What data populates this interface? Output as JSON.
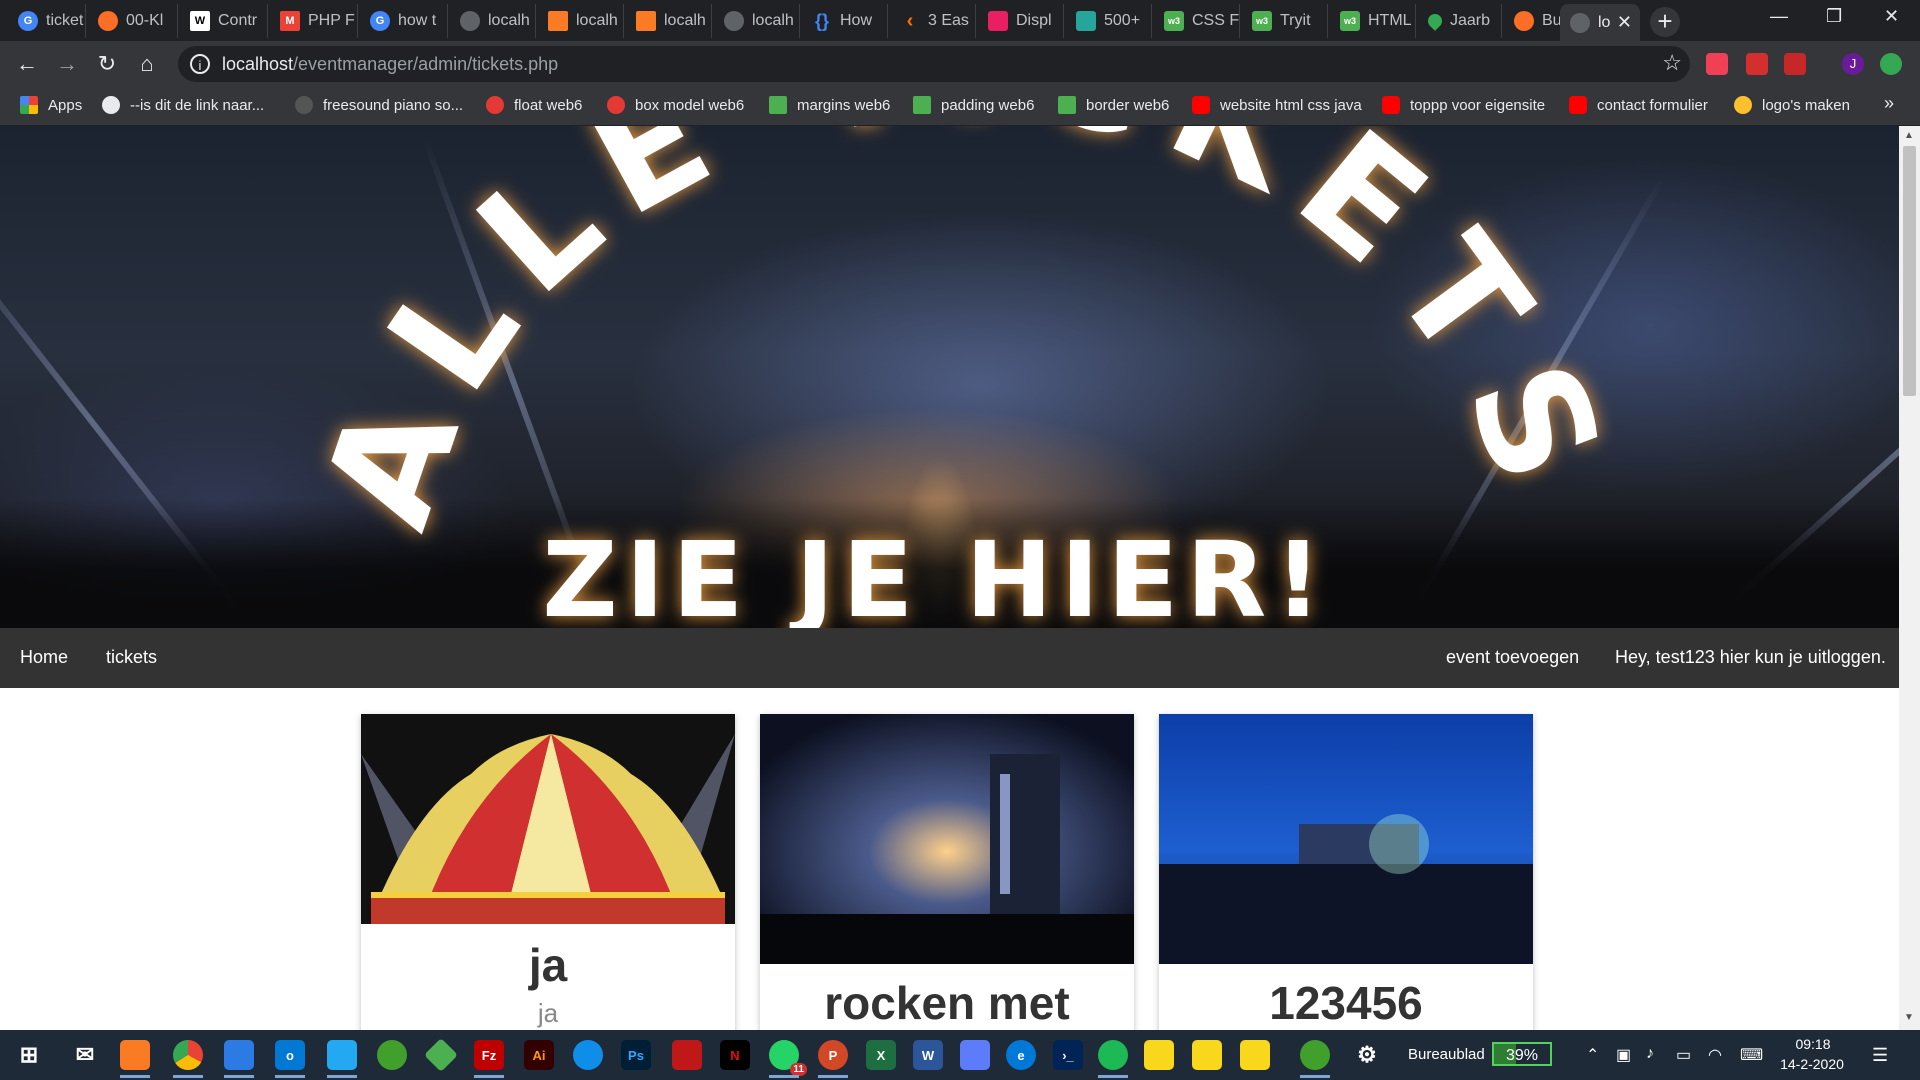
{
  "browser": {
    "tabs": [
      {
        "title": "ticket",
        "icon": "google-icon",
        "color": "#4285f4"
      },
      {
        "title": "00-Kl",
        "icon": "gitlab-icon",
        "color": "#fc6d26"
      },
      {
        "title": "Contr",
        "icon": "wikipedia-icon",
        "color": "#ffffff"
      },
      {
        "title": "PHP F",
        "icon": "gmail-icon",
        "color": "#ea4335"
      },
      {
        "title": "how t",
        "icon": "google-icon",
        "color": "#4285f4"
      },
      {
        "title": "localh",
        "icon": "globe-icon",
        "color": "#9aa0a6"
      },
      {
        "title": "localh",
        "icon": "xampp-icon",
        "color": "#fb7a24"
      },
      {
        "title": "localh",
        "icon": "xampp-icon",
        "color": "#fb7a24"
      },
      {
        "title": "localh",
        "icon": "globe-icon",
        "color": "#9aa0a6"
      },
      {
        "title": "How",
        "icon": "braces-icon",
        "color": "#4285f4"
      },
      {
        "title": "3 Eas",
        "icon": "chevron-icon",
        "color": "#ff6f00"
      },
      {
        "title": "Displ",
        "icon": "dribbble-icon",
        "color": "#e91e63"
      },
      {
        "title": "500+",
        "icon": "page-icon",
        "color": "#26a69a"
      },
      {
        "title": "CSS F",
        "icon": "w3schools-icon",
        "color": "#4caf50"
      },
      {
        "title": "Tryit",
        "icon": "w3schools-icon",
        "color": "#4caf50"
      },
      {
        "title": "HTML",
        "icon": "w3schools-icon",
        "color": "#4caf50"
      },
      {
        "title": "Jaarb",
        "icon": "maps-pin-icon",
        "color": "#34a853"
      },
      {
        "title": "Burnd",
        "icon": "gitlab-icon",
        "color": "#fc6d26"
      },
      {
        "title": "lo",
        "icon": "globe-icon",
        "color": "#9aa0a6",
        "active": true
      }
    ],
    "url_host": "localhost",
    "url_path": "/eventmanager/admin/tickets.php",
    "bookmarks": [
      {
        "label": "Apps",
        "icon": "apps-grid-icon",
        "color": "#ea4335"
      },
      {
        "label": "--is dit de link naar...",
        "icon": "globe-icon",
        "color": "#e8eaed"
      },
      {
        "label": "freesound piano so...",
        "icon": "freesound-icon",
        "color": "#555555"
      },
      {
        "label": "float web6",
        "icon": "web6-icon",
        "color": "#e53935"
      },
      {
        "label": "box model web6",
        "icon": "web6-icon",
        "color": "#e53935"
      },
      {
        "label": "margins web6",
        "icon": "w3schools-icon",
        "color": "#4caf50"
      },
      {
        "label": "padding web6",
        "icon": "w3schools-icon",
        "color": "#4caf50"
      },
      {
        "label": "border web6",
        "icon": "w3schools-icon",
        "color": "#4caf50"
      },
      {
        "label": "website html css java",
        "icon": "youtube-icon",
        "color": "#ff0000"
      },
      {
        "label": "toppp voor eigensite",
        "icon": "youtube-icon",
        "color": "#ff0000"
      },
      {
        "label": "contact formulier",
        "icon": "youtube-icon",
        "color": "#ff0000"
      },
      {
        "label": "logo's maken",
        "icon": "logo-maker-icon",
        "color": "#fbc02d"
      }
    ],
    "more_bookmarks": "»",
    "profile_initial": "J"
  },
  "hero": {
    "title_line1": "ALLE TICKETS",
    "title_line2": "ZIE JE HIER!"
  },
  "nav": {
    "left": [
      "Home",
      "tickets"
    ],
    "right": [
      "event toevoegen",
      "Hey, test123 hier kun je uitloggen."
    ]
  },
  "cards": [
    {
      "title": "ja",
      "subtitle": "ja",
      "image": "circus-tent-photo"
    },
    {
      "title": "rocken met",
      "subtitle": "",
      "image": "concert-stage-photo"
    },
    {
      "title": "123456",
      "subtitle": "",
      "image": "festival-crowd-photo"
    }
  ],
  "taskbar": {
    "desktop_label": "Bureaublad",
    "battery": "39%",
    "time": "09:18",
    "date": "14-2-2020",
    "whatsapp_badge": "11"
  }
}
